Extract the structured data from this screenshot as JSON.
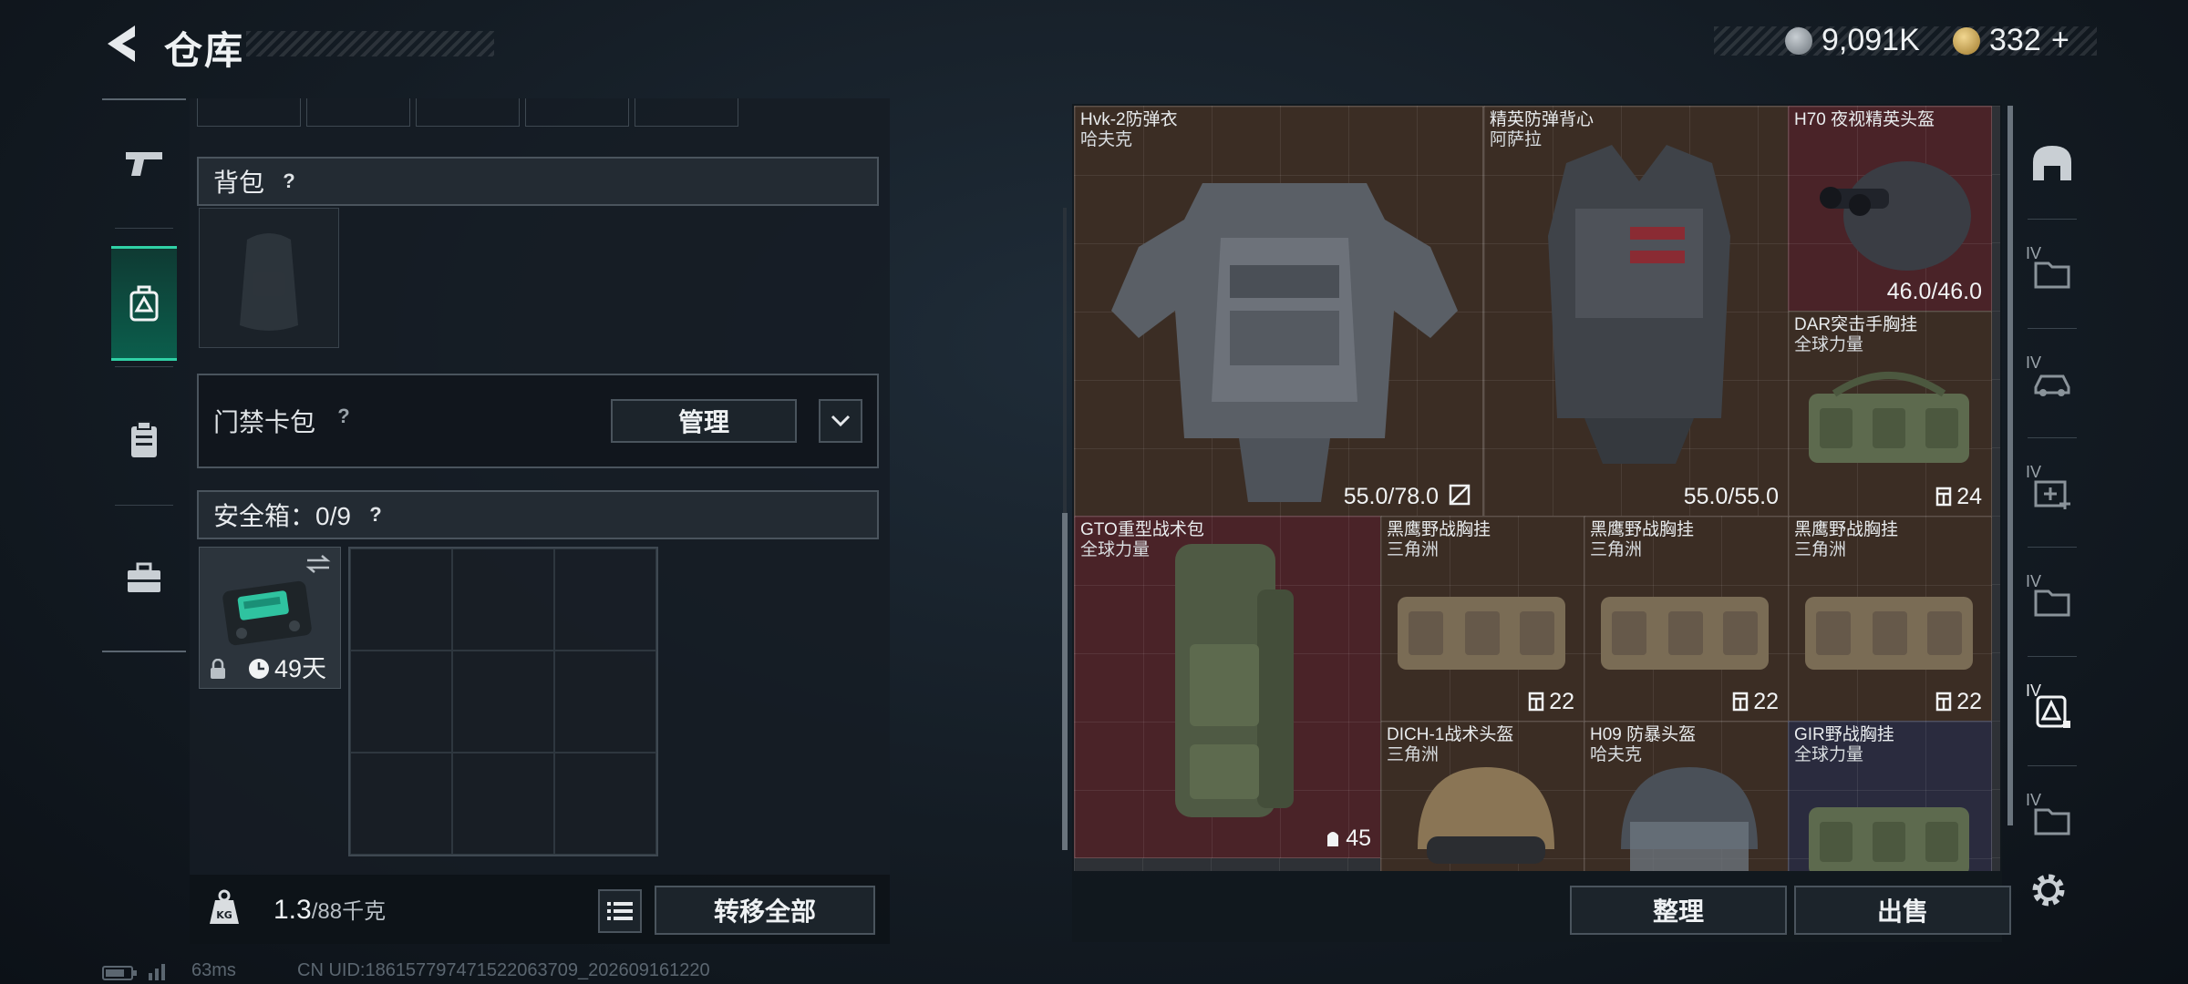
{
  "header": {
    "title": "仓库",
    "currency1": "9,091K",
    "currency2": "332",
    "currency2_add": "+"
  },
  "left_nav": {
    "items": [
      "weapons-icon",
      "equipment-icon",
      "clipboard-icon",
      "briefcase-icon"
    ],
    "active_index": 1
  },
  "left_panel": {
    "backpack_label": "背包",
    "keycard_label": "门禁卡包",
    "manage_label": "管理",
    "safebox_label": "安全箱：0/9",
    "help": "?",
    "safebox_timer": "49天"
  },
  "bottom_left": {
    "weight_current": "1.3",
    "weight_max": "/88千克",
    "transfer_all": "转移全部"
  },
  "status": {
    "ping": "63ms",
    "uid": "CN UID:186157797471522063709_202609161220"
  },
  "inventory": [
    {
      "name": "Hvk-2防弹衣",
      "sub": "哈夫克",
      "value": "55.0/78.0",
      "color": "brown"
    },
    {
      "name": "精英防弹背心",
      "sub": "阿萨拉",
      "value": "55.0/55.0",
      "color": "brown"
    },
    {
      "name": "H70 夜视精英头盔",
      "sub": "",
      "value": "46.0/46.0",
      "color": "red"
    },
    {
      "name": "DAR突击手胸挂",
      "sub": "全球力量",
      "value": "24",
      "color": "brown"
    },
    {
      "name": "GTO重型战术包",
      "sub": "全球力量",
      "value": "45",
      "color": "red"
    },
    {
      "name": "黑鹰野战胸挂",
      "sub": "三角洲",
      "value": "22",
      "color": "brown"
    },
    {
      "name": "黑鹰野战胸挂",
      "sub": "三角洲",
      "value": "22",
      "color": "brown"
    },
    {
      "name": "黑鹰野战胸挂",
      "sub": "三角洲",
      "value": "22",
      "color": "brown"
    },
    {
      "name": "DICH-1战术头盔",
      "sub": "三角洲",
      "value": "",
      "color": "brown"
    },
    {
      "name": "H09 防暴头盔",
      "sub": "哈夫克",
      "value": "",
      "color": "brown"
    },
    {
      "name": "GIR野战胸挂",
      "sub": "全球力量",
      "value": "",
      "color": "navy"
    }
  ],
  "actions": {
    "sort": "整理",
    "sell": "出售"
  },
  "right_tabs": {
    "items": [
      "helmet-tab-icon",
      "folder-tab-icon",
      "vehicle-tab-icon",
      "medkit-tab-icon",
      "folder-tab-icon",
      "equipment-tab-icon",
      "folder-tab-icon"
    ],
    "tier_label": "IV"
  },
  "colors": {
    "accent": "#30d1a6",
    "item_brown": "#3b2d24",
    "item_red": "#4a2328",
    "item_navy": "#2a2b3e"
  }
}
